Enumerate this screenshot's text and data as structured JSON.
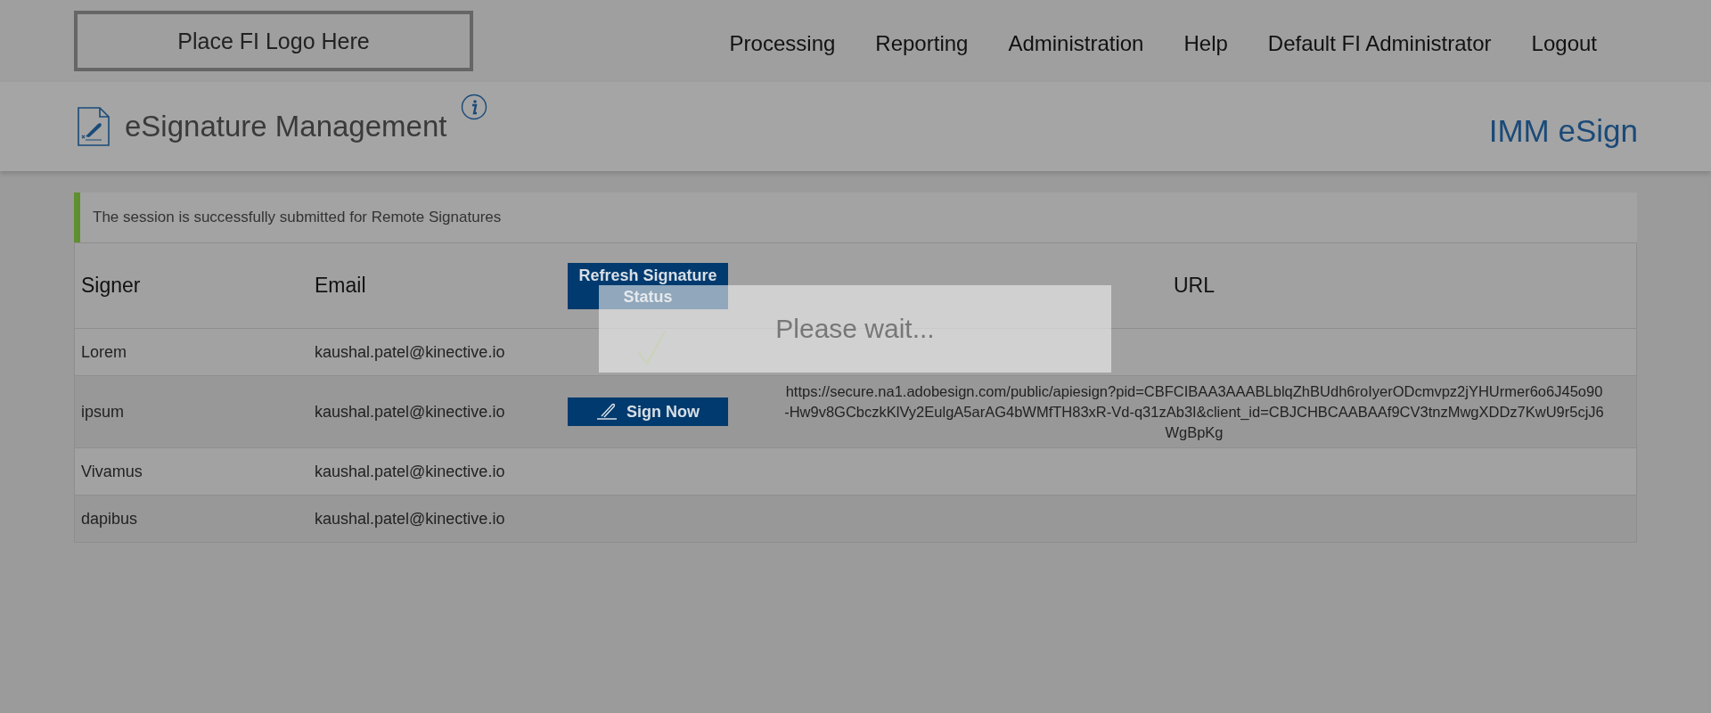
{
  "header": {
    "logo": "Place FI Logo Here",
    "nav": [
      "Processing",
      "Reporting",
      "Administration",
      "Help",
      "Default FI Administrator",
      "Logout"
    ]
  },
  "page": {
    "title": "eSignature Management",
    "app_name": "IMM eSign"
  },
  "alert": {
    "text": "The session is successfully submitted for Remote Signatures"
  },
  "table": {
    "columns": [
      "Signer",
      "Email",
      "URL"
    ],
    "refresh_button": "Refresh Signature Status",
    "rows": [
      {
        "signer": "Lorem",
        "email": "kaushal.patel@kinective.io"
      },
      {
        "signer": "ipsum",
        "email": "kaushal.patel@kinective.io",
        "sign_button": "Sign Now",
        "url": "https://secure.na1.adobesign.com/public/apiesign?pid=CBFCIBAA3AAABLblqZhBUdh6roIyerODcmvpz2jYHUrmer6o6J45o90-Hw9v8GCbczkKlVy2EulgA5arAG4bWMfTH83xR-Vd-q31zAb3I&client_id=CBJCHBCAABAAf9CV3tnzMwgXDDz7KwU9r5cjJ6WgBpKg"
      },
      {
        "signer": "Vivamus",
        "email": "kaushal.patel@kinective.io"
      },
      {
        "signer": "dapibus",
        "email": "kaushal.patel@kinective.io"
      }
    ]
  },
  "loading": {
    "text": "Please wait..."
  }
}
